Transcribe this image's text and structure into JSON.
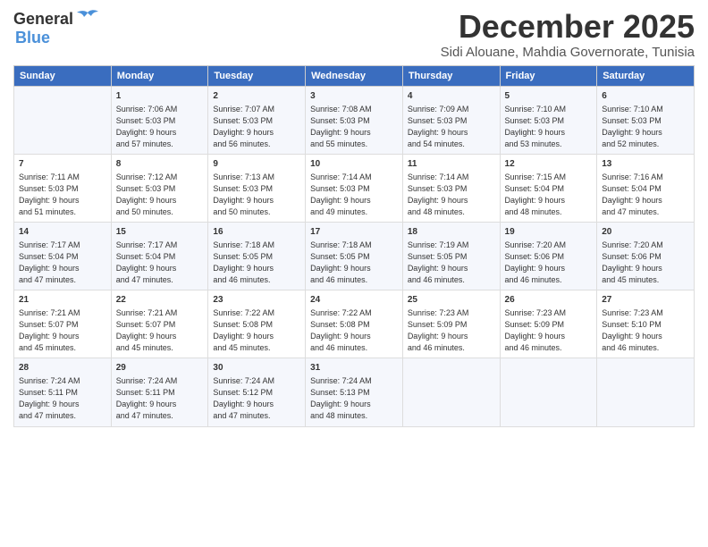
{
  "logo": {
    "line1": "General",
    "line2": "Blue"
  },
  "title": "December 2025",
  "subtitle": "Sidi Alouane, Mahdia Governorate, Tunisia",
  "header_row": [
    "Sunday",
    "Monday",
    "Tuesday",
    "Wednesday",
    "Thursday",
    "Friday",
    "Saturday"
  ],
  "weeks": [
    [
      {
        "day": "",
        "info": ""
      },
      {
        "day": "1",
        "info": "Sunrise: 7:06 AM\nSunset: 5:03 PM\nDaylight: 9 hours\nand 57 minutes."
      },
      {
        "day": "2",
        "info": "Sunrise: 7:07 AM\nSunset: 5:03 PM\nDaylight: 9 hours\nand 56 minutes."
      },
      {
        "day": "3",
        "info": "Sunrise: 7:08 AM\nSunset: 5:03 PM\nDaylight: 9 hours\nand 55 minutes."
      },
      {
        "day": "4",
        "info": "Sunrise: 7:09 AM\nSunset: 5:03 PM\nDaylight: 9 hours\nand 54 minutes."
      },
      {
        "day": "5",
        "info": "Sunrise: 7:10 AM\nSunset: 5:03 PM\nDaylight: 9 hours\nand 53 minutes."
      },
      {
        "day": "6",
        "info": "Sunrise: 7:10 AM\nSunset: 5:03 PM\nDaylight: 9 hours\nand 52 minutes."
      }
    ],
    [
      {
        "day": "7",
        "info": "Sunrise: 7:11 AM\nSunset: 5:03 PM\nDaylight: 9 hours\nand 51 minutes."
      },
      {
        "day": "8",
        "info": "Sunrise: 7:12 AM\nSunset: 5:03 PM\nDaylight: 9 hours\nand 50 minutes."
      },
      {
        "day": "9",
        "info": "Sunrise: 7:13 AM\nSunset: 5:03 PM\nDaylight: 9 hours\nand 50 minutes."
      },
      {
        "day": "10",
        "info": "Sunrise: 7:14 AM\nSunset: 5:03 PM\nDaylight: 9 hours\nand 49 minutes."
      },
      {
        "day": "11",
        "info": "Sunrise: 7:14 AM\nSunset: 5:03 PM\nDaylight: 9 hours\nand 48 minutes."
      },
      {
        "day": "12",
        "info": "Sunrise: 7:15 AM\nSunset: 5:04 PM\nDaylight: 9 hours\nand 48 minutes."
      },
      {
        "day": "13",
        "info": "Sunrise: 7:16 AM\nSunset: 5:04 PM\nDaylight: 9 hours\nand 47 minutes."
      }
    ],
    [
      {
        "day": "14",
        "info": "Sunrise: 7:17 AM\nSunset: 5:04 PM\nDaylight: 9 hours\nand 47 minutes."
      },
      {
        "day": "15",
        "info": "Sunrise: 7:17 AM\nSunset: 5:04 PM\nDaylight: 9 hours\nand 47 minutes."
      },
      {
        "day": "16",
        "info": "Sunrise: 7:18 AM\nSunset: 5:05 PM\nDaylight: 9 hours\nand 46 minutes."
      },
      {
        "day": "17",
        "info": "Sunrise: 7:18 AM\nSunset: 5:05 PM\nDaylight: 9 hours\nand 46 minutes."
      },
      {
        "day": "18",
        "info": "Sunrise: 7:19 AM\nSunset: 5:05 PM\nDaylight: 9 hours\nand 46 minutes."
      },
      {
        "day": "19",
        "info": "Sunrise: 7:20 AM\nSunset: 5:06 PM\nDaylight: 9 hours\nand 46 minutes."
      },
      {
        "day": "20",
        "info": "Sunrise: 7:20 AM\nSunset: 5:06 PM\nDaylight: 9 hours\nand 45 minutes."
      }
    ],
    [
      {
        "day": "21",
        "info": "Sunrise: 7:21 AM\nSunset: 5:07 PM\nDaylight: 9 hours\nand 45 minutes."
      },
      {
        "day": "22",
        "info": "Sunrise: 7:21 AM\nSunset: 5:07 PM\nDaylight: 9 hours\nand 45 minutes."
      },
      {
        "day": "23",
        "info": "Sunrise: 7:22 AM\nSunset: 5:08 PM\nDaylight: 9 hours\nand 45 minutes."
      },
      {
        "day": "24",
        "info": "Sunrise: 7:22 AM\nSunset: 5:08 PM\nDaylight: 9 hours\nand 46 minutes."
      },
      {
        "day": "25",
        "info": "Sunrise: 7:23 AM\nSunset: 5:09 PM\nDaylight: 9 hours\nand 46 minutes."
      },
      {
        "day": "26",
        "info": "Sunrise: 7:23 AM\nSunset: 5:09 PM\nDaylight: 9 hours\nand 46 minutes."
      },
      {
        "day": "27",
        "info": "Sunrise: 7:23 AM\nSunset: 5:10 PM\nDaylight: 9 hours\nand 46 minutes."
      }
    ],
    [
      {
        "day": "28",
        "info": "Sunrise: 7:24 AM\nSunset: 5:11 PM\nDaylight: 9 hours\nand 47 minutes."
      },
      {
        "day": "29",
        "info": "Sunrise: 7:24 AM\nSunset: 5:11 PM\nDaylight: 9 hours\nand 47 minutes."
      },
      {
        "day": "30",
        "info": "Sunrise: 7:24 AM\nSunset: 5:12 PM\nDaylight: 9 hours\nand 47 minutes."
      },
      {
        "day": "31",
        "info": "Sunrise: 7:24 AM\nSunset: 5:13 PM\nDaylight: 9 hours\nand 48 minutes."
      },
      {
        "day": "",
        "info": ""
      },
      {
        "day": "",
        "info": ""
      },
      {
        "day": "",
        "info": ""
      }
    ]
  ]
}
